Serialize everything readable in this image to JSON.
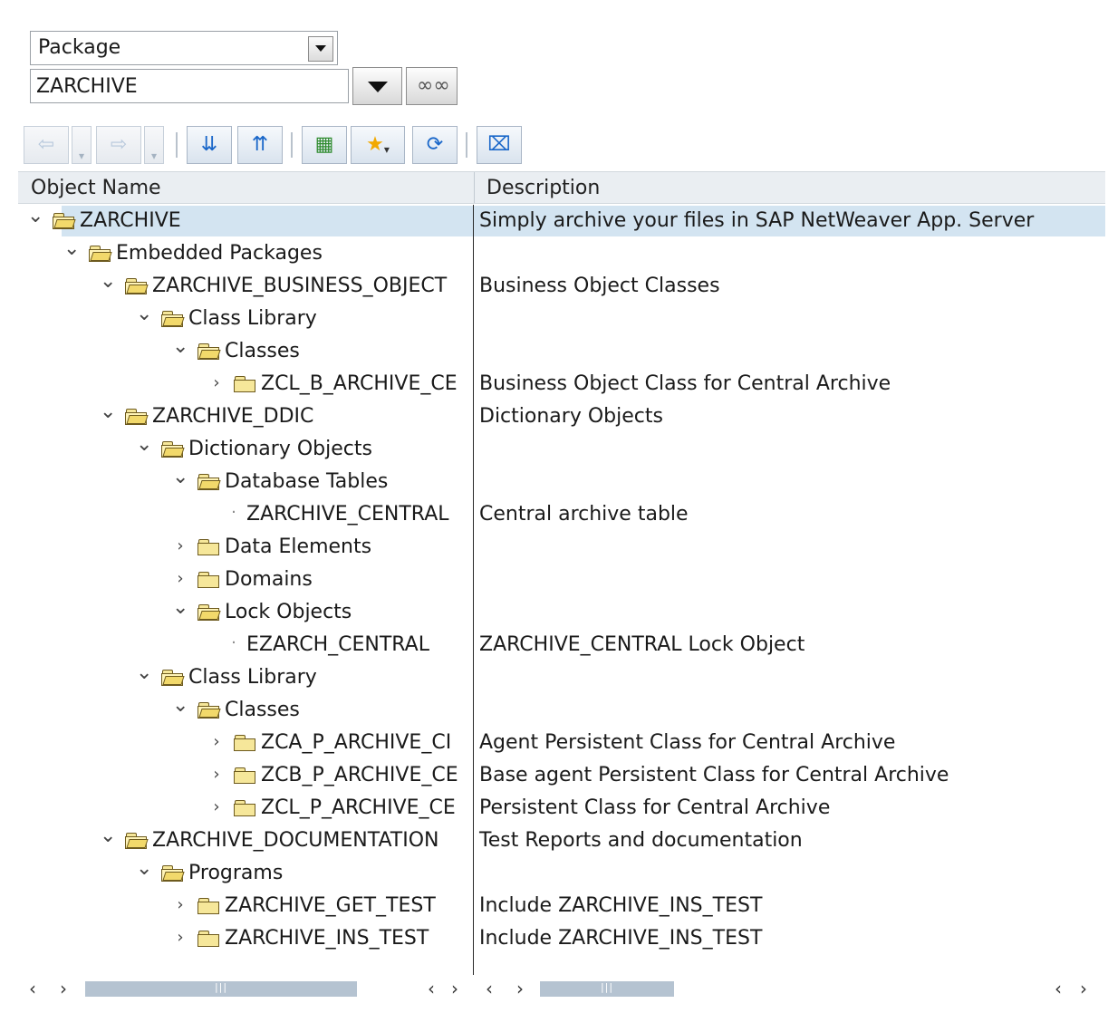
{
  "selector": {
    "type_value": "Package",
    "object_value": "ZARCHIVE"
  },
  "toolbar": {
    "icons": [
      "back-icon",
      "back-menu-icon",
      "forward-icon",
      "forward-menu-icon",
      "expand-all-icon",
      "collapse-all-icon",
      "hierarchy-icon",
      "favorites-icon",
      "refresh-icon",
      "close-icon"
    ]
  },
  "columns": {
    "name": "Object Name",
    "description": "Description"
  },
  "tree": [
    {
      "level": 0,
      "kind": "folder-open",
      "toggle": "open",
      "name": "ZARCHIVE",
      "desc": "Simply archive your files in SAP NetWeaver App. Server",
      "selected": true
    },
    {
      "level": 1,
      "kind": "folder-open",
      "toggle": "open",
      "name": "Embedded Packages",
      "desc": ""
    },
    {
      "level": 2,
      "kind": "folder-open",
      "toggle": "open",
      "name": "ZARCHIVE_BUSINESS_OBJECT",
      "desc": "Business Object Classes"
    },
    {
      "level": 3,
      "kind": "folder-open",
      "toggle": "open",
      "name": "Class Library",
      "desc": ""
    },
    {
      "level": 4,
      "kind": "folder-open",
      "toggle": "open",
      "name": "Classes",
      "desc": ""
    },
    {
      "level": 5,
      "kind": "folder-closed",
      "toggle": "closed",
      "name": "ZCL_B_ARCHIVE_CE",
      "desc": "Business Object Class for Central Archive"
    },
    {
      "level": 2,
      "kind": "folder-open",
      "toggle": "open",
      "name": "ZARCHIVE_DDIC",
      "desc": "Dictionary Objects"
    },
    {
      "level": 3,
      "kind": "folder-open",
      "toggle": "open",
      "name": "Dictionary Objects",
      "desc": ""
    },
    {
      "level": 4,
      "kind": "folder-open",
      "toggle": "open",
      "name": "Database Tables",
      "desc": ""
    },
    {
      "level": 5,
      "kind": "leaf",
      "toggle": "none",
      "name": "ZARCHIVE_CENTRAL",
      "desc": "Central archive table"
    },
    {
      "level": 4,
      "kind": "folder-closed",
      "toggle": "closed",
      "name": "Data Elements",
      "desc": ""
    },
    {
      "level": 4,
      "kind": "folder-closed",
      "toggle": "closed",
      "name": "Domains",
      "desc": ""
    },
    {
      "level": 4,
      "kind": "folder-open",
      "toggle": "open",
      "name": "Lock Objects",
      "desc": ""
    },
    {
      "level": 5,
      "kind": "leaf",
      "toggle": "none",
      "name": "EZARCH_CENTRAL",
      "desc": "ZARCHIVE_CENTRAL Lock Object"
    },
    {
      "level": 3,
      "kind": "folder-open",
      "toggle": "open",
      "name": "Class Library",
      "desc": ""
    },
    {
      "level": 4,
      "kind": "folder-open",
      "toggle": "open",
      "name": "Classes",
      "desc": ""
    },
    {
      "level": 5,
      "kind": "folder-closed",
      "toggle": "closed",
      "name": "ZCA_P_ARCHIVE_CI",
      "desc": "Agent Persistent Class for Central Archive"
    },
    {
      "level": 5,
      "kind": "folder-closed",
      "toggle": "closed",
      "name": "ZCB_P_ARCHIVE_CE",
      "desc": "Base agent Persistent Class for Central Archive"
    },
    {
      "level": 5,
      "kind": "folder-closed",
      "toggle": "closed",
      "name": "ZCL_P_ARCHIVE_CE",
      "desc": "Persistent Class for Central Archive"
    },
    {
      "level": 2,
      "kind": "folder-open",
      "toggle": "open",
      "name": "ZARCHIVE_DOCUMENTATION",
      "desc": "Test Reports and documentation"
    },
    {
      "level": 3,
      "kind": "folder-open",
      "toggle": "open",
      "name": "Programs",
      "desc": ""
    },
    {
      "level": 4,
      "kind": "folder-closed",
      "toggle": "closed",
      "name": "ZARCHIVE_GET_TEST",
      "desc": "Include ZARCHIVE_INS_TEST"
    },
    {
      "level": 4,
      "kind": "folder-closed",
      "toggle": "closed",
      "name": "ZARCHIVE_INS_TEST",
      "desc": "Include ZARCHIVE_INS_TEST"
    }
  ]
}
